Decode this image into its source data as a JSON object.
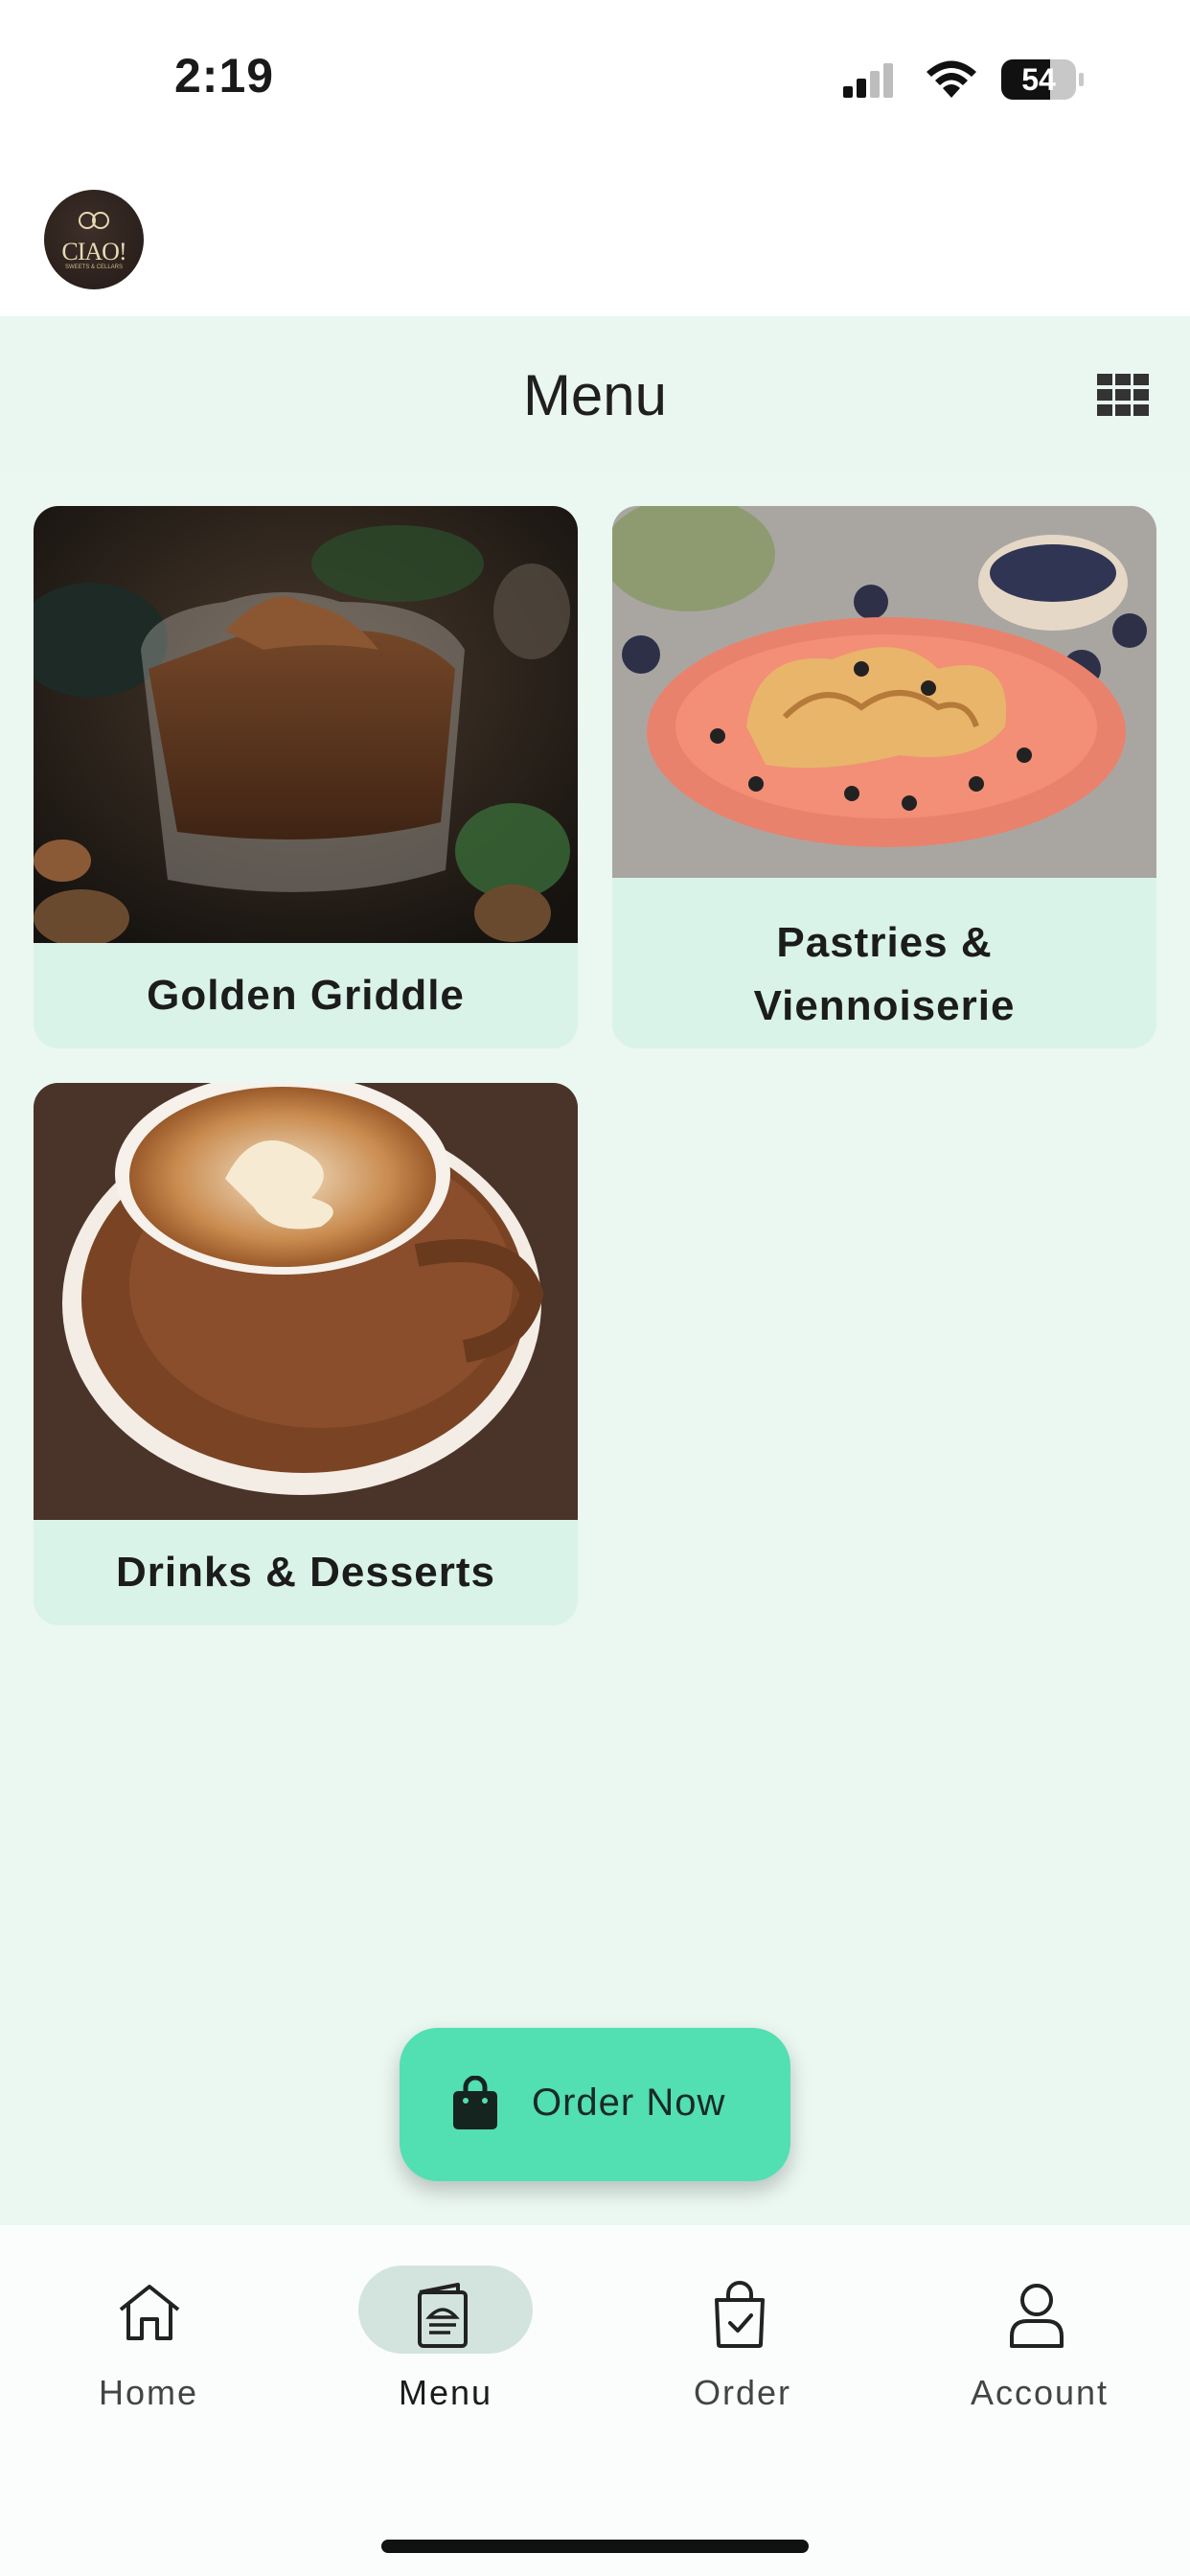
{
  "status": {
    "time": "2:19",
    "battery": "54"
  },
  "brand": {
    "logo_text": "CIAO!",
    "logo_sub": "SWEETS & CELLARS"
  },
  "header": {
    "title": "Menu",
    "view_toggle_icon": "grid-view-icon"
  },
  "categories": [
    {
      "label": "Golden Griddle",
      "image": "chocolate-mousse-glass"
    },
    {
      "label_line1": "Pastries &",
      "label_line2": "Viennoiserie",
      "image": "pastries-plate-blueberries"
    },
    {
      "label": "Drinks & Desserts",
      "image": "latte-art-cup"
    }
  ],
  "order_button": {
    "label": "Order Now",
    "icon": "shopping-bag-icon"
  },
  "nav": {
    "active": "Menu",
    "items": [
      {
        "label": "Home",
        "icon": "home-icon"
      },
      {
        "label": "Menu",
        "icon": "menu-book-icon"
      },
      {
        "label": "Order",
        "icon": "order-bag-icon"
      },
      {
        "label": "Account",
        "icon": "account-icon"
      }
    ]
  },
  "colors": {
    "accent": "#52dfb2",
    "page_bg": "#ebf7f1",
    "card_bg": "#daf3e9",
    "nav_active_pill": "#d3e4df"
  }
}
